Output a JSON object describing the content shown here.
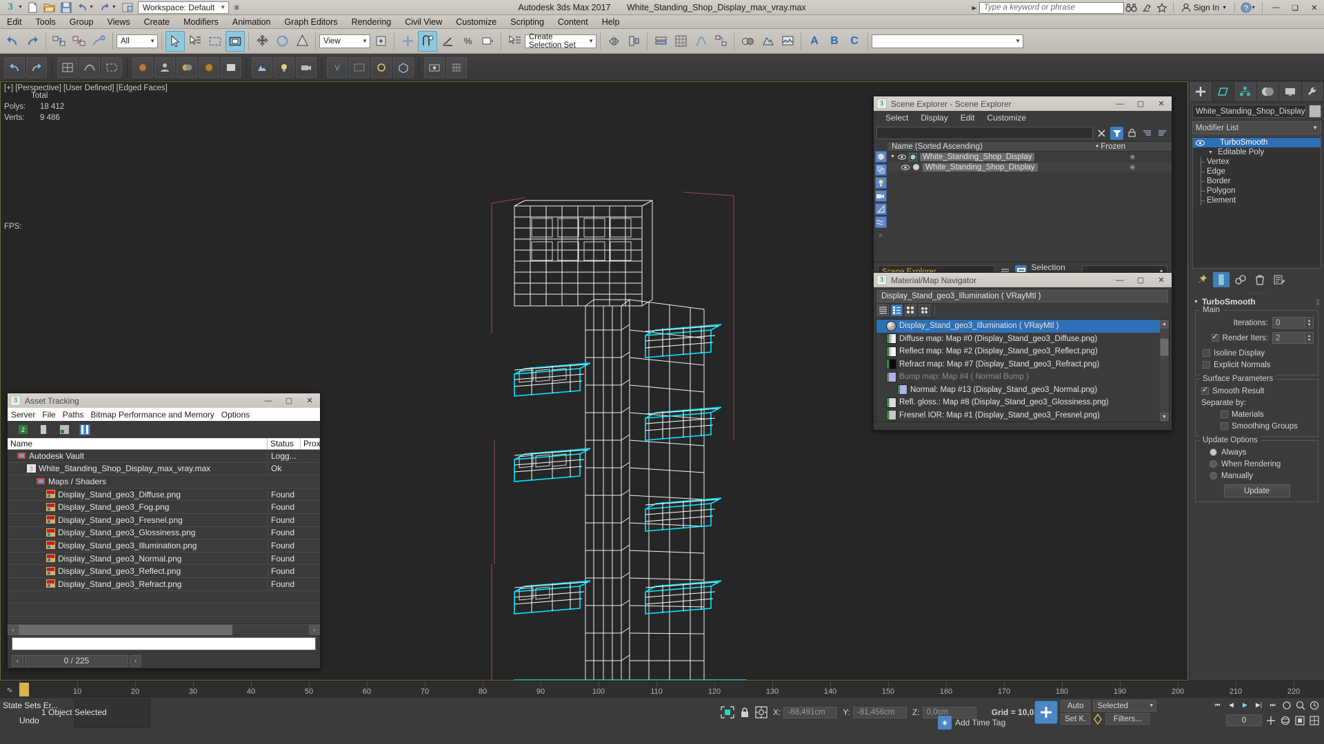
{
  "titlebar": {
    "app_title": "Autodesk 3ds Max 2017",
    "file_name": "White_Standing_Shop_Display_max_vray.max",
    "workspace_label": "Workspace: Default",
    "search_placeholder": "Type a keyword or phrase",
    "sign_in": "Sign In",
    "minimize": "—",
    "maximize": "❑",
    "close": "✕"
  },
  "menubar": {
    "items": [
      "Edit",
      "Tools",
      "Group",
      "Views",
      "Create",
      "Modifiers",
      "Animation",
      "Graph Editors",
      "Rendering",
      "Civil View",
      "Customize",
      "Scripting",
      "Content",
      "Help"
    ]
  },
  "toolbar": {
    "selection_filter": "All",
    "view_coord": "View",
    "selection_set": "Create Selection Set"
  },
  "viewport": {
    "label": "[+] [Perspective] [User Defined] [Edged Faces]",
    "total_label": "Total",
    "polys_key": "Polys:",
    "polys_value": "18 412",
    "verts_key": "Verts:",
    "verts_value": "9 486",
    "fps_label": "FPS:"
  },
  "scene_explorer": {
    "title": "Scene Explorer - Scene Explorer",
    "menu": [
      "Select",
      "Display",
      "Edit",
      "Customize"
    ],
    "columns": {
      "name": "Name (Sorted Ascending)",
      "frozen": "Frozen"
    },
    "rows": [
      {
        "name": "White_Standing_Shop_Display",
        "indent": 0,
        "frozen": "✳"
      },
      {
        "name": "White_Standing_Shop_Display",
        "indent": 1,
        "frozen": "✳"
      }
    ],
    "footer_name": "Scene Explorer",
    "selection_set_label": "Selection Set:",
    "selection_set_value": ""
  },
  "material_navigator": {
    "title": "Material/Map Navigator",
    "current": "Display_Stand_geo3_Illumination  ( VRayMtl )",
    "rows": [
      {
        "text": "Display_Stand_geo3_Illumination  ( VRayMtl )",
        "selected": true,
        "dim": false,
        "indent": 0,
        "swatch": "#9e9e9e"
      },
      {
        "text": "Diffuse map: Map #0 (Display_Stand_geo3_Diffuse.png)",
        "selected": false,
        "dim": false,
        "indent": 0,
        "swatch": "#cfcfcf"
      },
      {
        "text": "Reflect map: Map #2 (Display_Stand_geo3_Reflect.png)",
        "selected": false,
        "dim": false,
        "indent": 0,
        "swatch": "#d8d8d8"
      },
      {
        "text": "Refract map: Map #7 (Display_Stand_geo3_Refract.png)",
        "selected": false,
        "dim": false,
        "indent": 0,
        "swatch": "#0a0a0a"
      },
      {
        "text": "Bump map: Map #4  ( Normal Bump )",
        "selected": false,
        "dim": true,
        "indent": 0,
        "swatch": "#b3b0e8"
      },
      {
        "text": "Normal: Map #13 (Display_Stand_geo3_Normal.png)",
        "selected": false,
        "dim": false,
        "indent": 1,
        "swatch": "#b3b0e8"
      },
      {
        "text": "Refl. gloss.: Map #8 (Display_Stand_geo3_Glossiness.png)",
        "selected": false,
        "dim": false,
        "indent": 0,
        "swatch": "#dcdcdc"
      },
      {
        "text": "Fresnel IOR: Map #1 (Display_Stand_geo3_Fresnel.png)",
        "selected": false,
        "dim": false,
        "indent": 0,
        "swatch": "#c8c8c8"
      },
      {
        "text": "",
        "selected": false,
        "dim": false,
        "indent": 0,
        "swatch": "#0a0a0a"
      }
    ]
  },
  "asset_tracking": {
    "title": "Asset Tracking",
    "menu": [
      "Server",
      "File",
      "Paths",
      "Bitmap Performance and Memory",
      "Options"
    ],
    "columns": [
      "Name",
      "Status",
      "Prox"
    ],
    "rows": [
      {
        "name": "Autodesk Vault",
        "status": "Logg...",
        "prox": "",
        "indent": 1,
        "icon": "folder"
      },
      {
        "name": "White_Standing_Shop_Display_max_vray.max",
        "status": "Ok",
        "prox": "",
        "indent": 2,
        "icon": "max"
      },
      {
        "name": "Maps / Shaders",
        "status": "",
        "prox": "",
        "indent": 3,
        "icon": "folder"
      },
      {
        "name": "Display_Stand_geo3_Diffuse.png",
        "status": "Found",
        "prox": "",
        "indent": 4,
        "icon": "png"
      },
      {
        "name": "Display_Stand_geo3_Fog.png",
        "status": "Found",
        "prox": "",
        "indent": 4,
        "icon": "png"
      },
      {
        "name": "Display_Stand_geo3_Fresnel.png",
        "status": "Found",
        "prox": "",
        "indent": 4,
        "icon": "png"
      },
      {
        "name": "Display_Stand_geo3_Glossiness.png",
        "status": "Found",
        "prox": "",
        "indent": 4,
        "icon": "png"
      },
      {
        "name": "Display_Stand_geo3_Illumination.png",
        "status": "Found",
        "prox": "",
        "indent": 4,
        "icon": "png"
      },
      {
        "name": "Display_Stand_geo3_Normal.png",
        "status": "Found",
        "prox": "",
        "indent": 4,
        "icon": "png"
      },
      {
        "name": "Display_Stand_geo3_Reflect.png",
        "status": "Found",
        "prox": "",
        "indent": 4,
        "icon": "png"
      },
      {
        "name": "Display_Stand_geo3_Refract.png",
        "status": "Found",
        "prox": "",
        "indent": 4,
        "icon": "png"
      }
    ],
    "progress": "0 / 225",
    "scroll_left": "‹",
    "scroll_right": "›"
  },
  "command_panel": {
    "object_name": "White_Standing_Shop_Display",
    "modifier_list_label": "Modifier List",
    "stack": [
      {
        "label": "TurboSmooth",
        "selected": true,
        "sub": false
      },
      {
        "label": "Editable Poly",
        "selected": false,
        "sub": false
      },
      {
        "label": "Vertex",
        "selected": false,
        "sub": true
      },
      {
        "label": "Edge",
        "selected": false,
        "sub": true
      },
      {
        "label": "Border",
        "selected": false,
        "sub": true
      },
      {
        "label": "Polygon",
        "selected": false,
        "sub": true
      },
      {
        "label": "Element",
        "selected": false,
        "sub": true
      }
    ],
    "rollout_title": "TurboSmooth",
    "main_group": "Main",
    "iterations_label": "Iterations:",
    "iterations_value": "0",
    "render_iters_label": "Render Iters:",
    "render_iters_value": "2",
    "render_iters_checked": true,
    "isoline_label": "Isoline Display",
    "isoline_checked": false,
    "explicit_label": "Explicit Normals",
    "explicit_checked": false,
    "surface_group": "Surface Parameters",
    "smooth_result_label": "Smooth Result",
    "smooth_result_checked": true,
    "separate_by_label": "Separate by:",
    "materials_label": "Materials",
    "materials_checked": false,
    "smoothing_groups_label": "Smoothing Groups",
    "smoothing_groups_checked": false,
    "update_group": "Update Options",
    "update_options": [
      {
        "label": "Always",
        "selected": true
      },
      {
        "label": "When Rendering",
        "selected": false
      },
      {
        "label": "Manually",
        "selected": false
      }
    ],
    "update_button": "Update"
  },
  "timeline": {
    "labels": [
      "10",
      "20",
      "30",
      "40",
      "50",
      "60",
      "70",
      "80",
      "90",
      "100",
      "110",
      "120",
      "130",
      "140",
      "150",
      "160",
      "170",
      "180",
      "190",
      "200",
      "210",
      "220"
    ],
    "start": 0,
    "end": 225
  },
  "statusbar": {
    "state_sets": "State Sets Er...",
    "undo": "Undo",
    "selection_info": "1 Object Selected",
    "x_label": "X:",
    "x_value": "-88,491cm",
    "y_label": "Y:",
    "y_value": "-81,456cm",
    "z_label": "Z:",
    "z_value": "0,0cm",
    "grid": "Grid = 10,0cm",
    "add_time_tag": "Add Time Tag",
    "auto_key": "Auto",
    "set_key": "Set K.",
    "selected_dropdown": "Selected",
    "filters": "Filters...",
    "key_frame_value": "0"
  },
  "colors": {
    "accent_blue": "#4c86c6",
    "cyan_selection": "#00e5ff",
    "yellow_border": "#6f6a35",
    "panel_bg": "#3b3b3b",
    "viewport_bg": "#262626"
  }
}
